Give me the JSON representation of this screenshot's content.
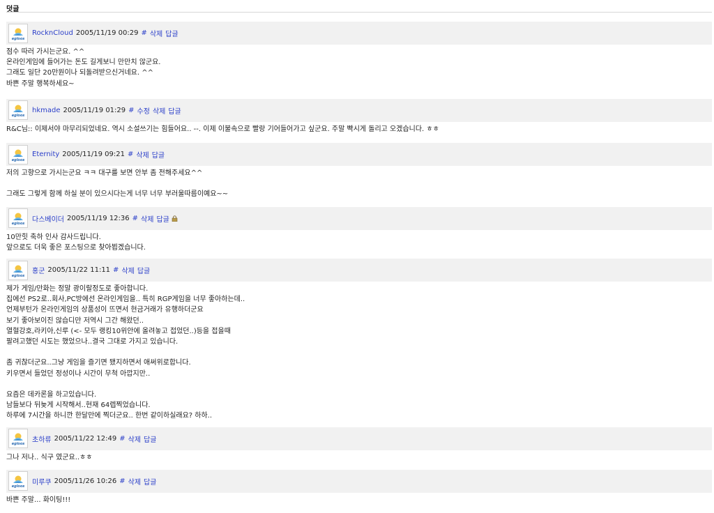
{
  "section_title": "덧글",
  "comments": [
    {
      "author": "RocknCloud",
      "date": "2005/11/19 00:29",
      "actions": [
        "#",
        "삭제",
        "답글"
      ],
      "lines": [
        "점수 따러 가시는군요. ^^",
        "온라인게임에 들어가는 돈도 길게보니 만만치 않군요.",
        "그래도 일단 20만원이나 되돌려받으신거네요. ^^",
        "바쁜 주말 행복하세요~"
      ]
    },
    {
      "author": "hkmade",
      "date": "2005/11/19 01:29",
      "actions": [
        "#",
        "수정",
        "삭제",
        "답글"
      ],
      "lines": [
        "R&C님:: 이제서야 마무리되었네요. 역시 소설쓰기는 힘들어요.. --. 이제 이불속으로 빨랑 기어들어가고 싶군요. 주말 빡시게 돌리고 오겠습니다. ㅎㅎ"
      ]
    },
    {
      "author": "Eternity",
      "date": "2005/11/19 09:21",
      "actions": [
        "#",
        "삭제",
        "답글"
      ],
      "lines": [
        "저의 고향으로 가시는군요 ㅋㅋ 대구를 보면 안부 좀 전해주세요^^",
        "",
        "그래도 그렇게 함께 하실 분이 있으시다는게 너무 너무 부러울따름이예요~~"
      ]
    },
    {
      "author": "다스베이더",
      "date": "2005/11/19 12:36",
      "actions": [
        "#",
        "삭제",
        "답글"
      ],
      "locked": true,
      "lines": [
        "10만힛 축하 인사 감사드립니다.",
        "앞으로도 더욱 좋은 포스팅으로 찾아뵙겠습니다."
      ]
    },
    {
      "author": "홍군",
      "date": "2005/11/22 11:11",
      "actions": [
        "#",
        "삭제",
        "답글"
      ],
      "lines": [
        "제가 게임/만화는 정말 광이랄정도로 좋아합니다.",
        "집에선 PS2로..회사,PC방에선 온라인게임을.. 특히 RGP게임을 너무 좋아하는데..",
        "언제부턴가 온라인게임의 상품성이 뜨면서 현금거래가 유행하더군요",
        "보기 좋아보이진 않습디만 저역시 그간 해왔던..",
        "열혈강호,라키아,신루 (<- 모두 랭킹10위안에 올려놓고 접었던..)등을 접을때",
        "팔려고했던 시도는 했었으나..결국 그대로 가지고 있습니다.",
        "",
        "좀 귀찮더군요..그냥 게임을 즐기면 됐지하면서 애써위로합니다.",
        "키우면서 들었던 정성이나 시간이 무척 아깝지만..",
        "",
        "요즘은 데카론을 하고있습니다.",
        "남들보다 뒤늦게 시작해서..현재 64렙찍었습니다.",
        "하루에 7시간을 하니깐 한달만에 찍더군요.. 한번 같이하실래요? 하하.."
      ]
    },
    {
      "author": "초하류",
      "date": "2005/11/22 12:49",
      "actions": [
        "#",
        "삭제",
        "답글"
      ],
      "lines": [
        "그나 저나.. 식구 였군요..ㅎㅎ"
      ]
    },
    {
      "author": "미루쿠",
      "date": "2005/11/26 10:26",
      "actions": [
        "#",
        "삭제",
        "답글"
      ],
      "lines": [
        "바쁜 주말... 화이팅!!!"
      ]
    }
  ],
  "avatar_logo_text": "egloos",
  "colors": {
    "link": "#2b3fc9",
    "header_bg": "#f1f1f1"
  },
  "icons": {
    "lock": "lock-icon"
  }
}
